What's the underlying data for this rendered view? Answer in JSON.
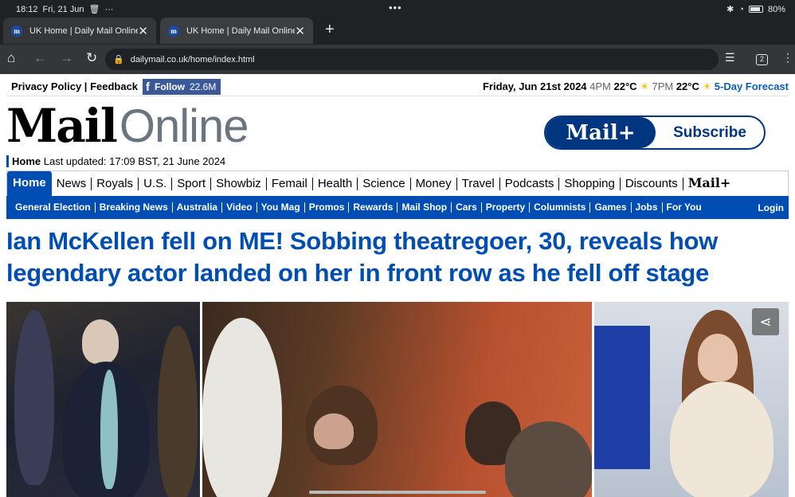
{
  "status_bar": {
    "time": "18:12",
    "date": "Fri, 21 Jun",
    "battery": "80%"
  },
  "tabs": [
    {
      "title": "UK Home | Daily Mail Online",
      "favicon": "m"
    },
    {
      "title": "UK Home | Daily Mail Online",
      "favicon": "m"
    }
  ],
  "toolbar": {
    "url": "dailymail.co.uk/home/index.html",
    "tab_count": "2"
  },
  "topbar": {
    "privacy": "Privacy Policy",
    "feedback": "Feedback",
    "follow_label": "Follow",
    "follow_count": "22.6M",
    "date": "Friday, Jun 21st 2024",
    "time1": "4PM",
    "temp1": "22°C",
    "time2": "7PM",
    "temp2": "22°C",
    "forecast": "5-Day Forecast"
  },
  "logo": {
    "mail": "Mail",
    "online": "Online"
  },
  "subscribe": {
    "brand": "Mail+",
    "label": "Subscribe"
  },
  "updated": {
    "section": "Home",
    "text": "Last updated: 17:09 BST, 21 June 2024"
  },
  "main_nav": {
    "home": "Home",
    "items": [
      "News",
      "Royals",
      "U.S.",
      "Sport",
      "Showbiz",
      "Femail",
      "Health",
      "Science",
      "Money",
      "Travel",
      "Podcasts",
      "Shopping",
      "Discounts"
    ],
    "mailplus": "Mail+"
  },
  "sub_nav": {
    "items": [
      "General Election",
      "Breaking News",
      "Australia",
      "Video",
      "You Mag",
      "Promos",
      "Rewards",
      "Mail Shop",
      "Cars",
      "Property",
      "Columnists",
      "Games",
      "Jobs",
      "For You"
    ],
    "login": "Login"
  },
  "headline": "Ian McKellen fell on ME! Sobbing theatregoer, 30, reveals how legendary actor landed on her in front row as he fell off stage"
}
